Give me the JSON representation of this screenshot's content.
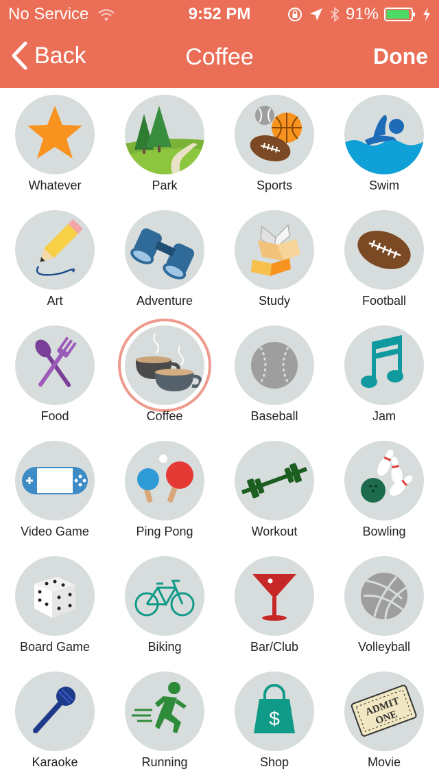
{
  "status": {
    "carrier": "No Service",
    "time": "9:52 PM",
    "battery": "91%"
  },
  "nav": {
    "back_label": "Back",
    "title": "Coffee",
    "done_label": "Done"
  },
  "colors": {
    "header": "#EB6E57",
    "circle": "#D7DCDC",
    "selected_ring": "#EE9A8C",
    "battery_fill": "#4CD964"
  },
  "selected_activity": "Coffee",
  "activities": [
    {
      "label": "Whatever",
      "icon": "star-icon"
    },
    {
      "label": "Park",
      "icon": "park-icon"
    },
    {
      "label": "Sports",
      "icon": "sports-balls-icon"
    },
    {
      "label": "Swim",
      "icon": "swimmer-icon"
    },
    {
      "label": "Art",
      "icon": "pencil-icon"
    },
    {
      "label": "Adventure",
      "icon": "binoculars-icon"
    },
    {
      "label": "Study",
      "icon": "books-icon"
    },
    {
      "label": "Football",
      "icon": "football-icon"
    },
    {
      "label": "Food",
      "icon": "fork-spoon-icon"
    },
    {
      "label": "Coffee",
      "icon": "coffee-cups-icon"
    },
    {
      "label": "Baseball",
      "icon": "baseball-icon"
    },
    {
      "label": "Jam",
      "icon": "music-note-icon"
    },
    {
      "label": "Video Game",
      "icon": "game-console-icon"
    },
    {
      "label": "Ping Pong",
      "icon": "ping-pong-icon"
    },
    {
      "label": "Workout",
      "icon": "barbell-icon"
    },
    {
      "label": "Bowling",
      "icon": "bowling-icon"
    },
    {
      "label": "Board Game",
      "icon": "dice-icon"
    },
    {
      "label": "Biking",
      "icon": "bicycle-icon"
    },
    {
      "label": "Bar/Club",
      "icon": "cocktail-icon"
    },
    {
      "label": "Volleyball",
      "icon": "volleyball-icon"
    },
    {
      "label": "Karaoke",
      "icon": "microphone-icon"
    },
    {
      "label": "Running",
      "icon": "runner-icon"
    },
    {
      "label": "Shop",
      "icon": "shopping-bag-icon"
    },
    {
      "label": "Movie",
      "icon": "admit-one-ticket-icon"
    }
  ],
  "ticket_text": [
    "ADMIT",
    "ONE"
  ]
}
